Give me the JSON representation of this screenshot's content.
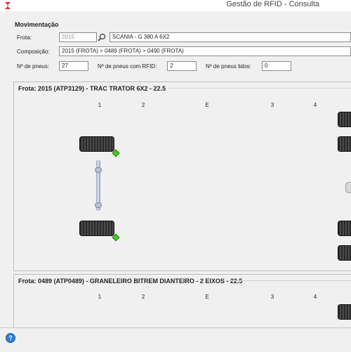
{
  "window": {
    "title": "Gestão de RFID - Consulta"
  },
  "movimentacao": {
    "section_title": "Movimentação",
    "frota": {
      "label": "Frota:",
      "code": "2015",
      "vehicle": "SCANIA - G 380 A 6X2"
    },
    "composicao": {
      "label": "Composição:",
      "value": "2015 (FROTA) > 0489 (FROTA) > 0490 (FROTA)"
    },
    "pneus": {
      "label": "Nº de pneus:",
      "value": "27"
    },
    "pneus_rfid": {
      "label": "Nº de pneus com RFID:",
      "value": "2"
    },
    "pneus_lidos": {
      "label": "Nº de pneus lidos:",
      "value": "0"
    }
  },
  "groups": [
    {
      "title": "Frota: 2015 (ATP3129) - TRAC TRATOR 6X2 - 22.5",
      "columns": [
        "1",
        "2",
        "E",
        "3",
        "4"
      ]
    },
    {
      "title": "Frota: 0489 (ATP0489) - GRANELEIRO BITREM DIANTEIRO - 2 EIXOS - 22.5",
      "columns": [
        "1",
        "2",
        "E",
        "3",
        "4"
      ]
    }
  ],
  "icons": {
    "logo": "app-logo-icon",
    "search": "search-icon",
    "help": "help-icon"
  },
  "colors": {
    "rfid_tag": "#4cc22a",
    "help": "#2f7fd1"
  }
}
